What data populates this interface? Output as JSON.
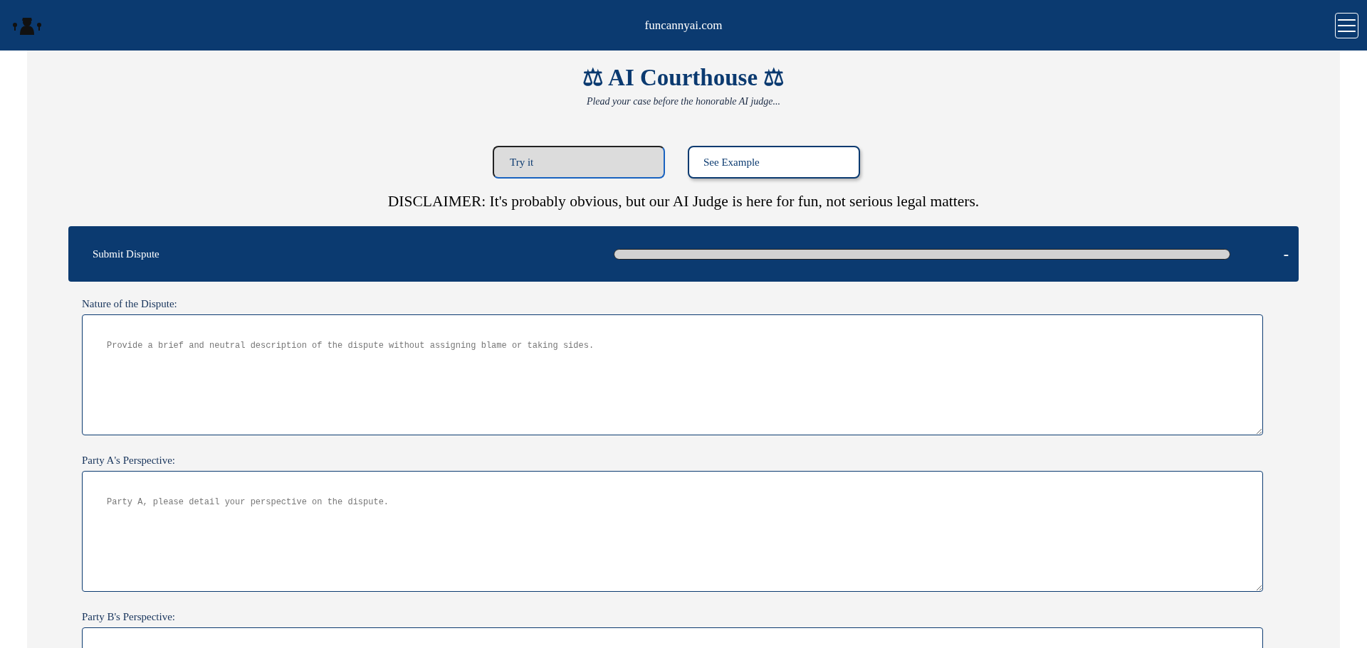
{
  "header": {
    "site_title": "funcannyai.com"
  },
  "intro": {
    "title": "⚖ AI Courthouse ⚖",
    "subtitle": "Plead your case before the honorable AI judge..."
  },
  "mode_buttons": [
    {
      "label": "Try it",
      "selected": true
    },
    {
      "label": "See Example",
      "selected": false
    }
  ],
  "disclaimer": "DISCLAIMER: It's probably obvious, but our AI Judge is here for fun, not serious legal matters.",
  "submit_panel": {
    "title": "Submit Dispute",
    "progress": {
      "level": 0
    },
    "toggle": "-"
  },
  "fields": [
    {
      "label": "Nature of the Dispute:",
      "placeholder": "Provide a brief and neutral description of the dispute without assigning blame or taking sides."
    },
    {
      "label": "Party A's Perspective:",
      "placeholder": "Party A, please detail your perspective on the dispute."
    },
    {
      "label": "Party B's Perspective:"
    }
  ]
}
